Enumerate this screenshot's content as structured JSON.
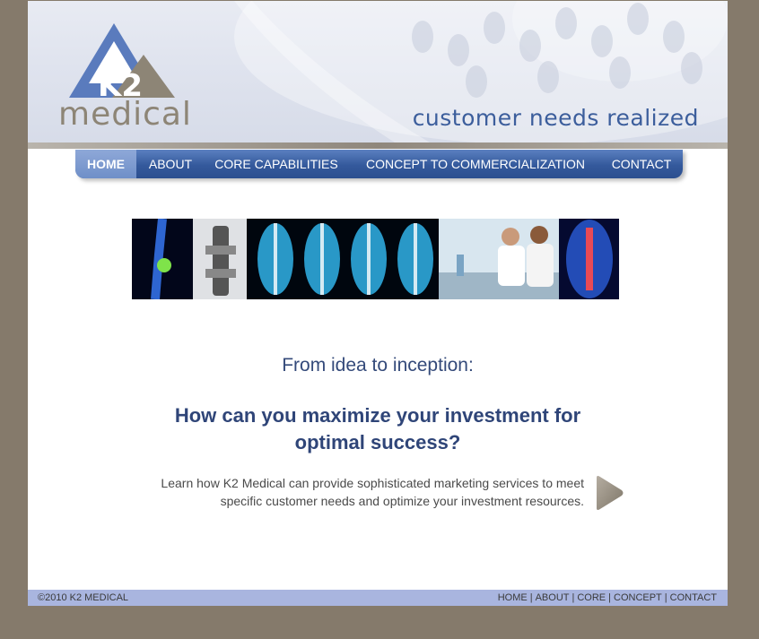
{
  "brand": {
    "logo_letters": "K2",
    "logo_word": "medical",
    "tagline": "customer needs realized"
  },
  "nav": {
    "items": [
      {
        "label": "HOME",
        "active": true
      },
      {
        "label": "ABOUT"
      },
      {
        "label": "CORE CAPABILITIES"
      },
      {
        "label": "CONCEPT TO COMMERCIALIZATION"
      },
      {
        "label": "CONTACT"
      }
    ]
  },
  "main": {
    "headline": "From idea to inception:",
    "question": "How can you maximize your investment for optimal success?",
    "body": "Learn how K2 Medical can provide sophisticated marketing services to meet specific customer needs and optimize your investment resources."
  },
  "footer": {
    "copyright": "©2010 K2 MEDICAL",
    "links": [
      "HOME",
      "ABOUT",
      "CORE",
      "CONCEPT",
      "CONTACT"
    ],
    "separator": "|"
  },
  "colors": {
    "background": "#857a6b",
    "nav_blue": "#34599c",
    "accent_blue": "#3c5e9c",
    "footer_bar": "#a9b5df",
    "logo_gray": "#8d8576"
  }
}
